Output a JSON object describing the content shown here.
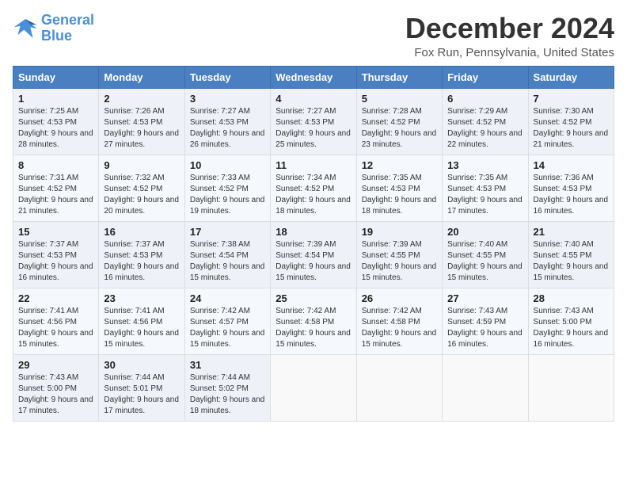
{
  "logo": {
    "line1": "General",
    "line2": "Blue"
  },
  "title": "December 2024",
  "location": "Fox Run, Pennsylvania, United States",
  "weekdays": [
    "Sunday",
    "Monday",
    "Tuesday",
    "Wednesday",
    "Thursday",
    "Friday",
    "Saturday"
  ],
  "weeks": [
    [
      {
        "day": "1",
        "sunrise": "Sunrise: 7:25 AM",
        "sunset": "Sunset: 4:53 PM",
        "daylight": "Daylight: 9 hours and 28 minutes."
      },
      {
        "day": "2",
        "sunrise": "Sunrise: 7:26 AM",
        "sunset": "Sunset: 4:53 PM",
        "daylight": "Daylight: 9 hours and 27 minutes."
      },
      {
        "day": "3",
        "sunrise": "Sunrise: 7:27 AM",
        "sunset": "Sunset: 4:53 PM",
        "daylight": "Daylight: 9 hours and 26 minutes."
      },
      {
        "day": "4",
        "sunrise": "Sunrise: 7:27 AM",
        "sunset": "Sunset: 4:53 PM",
        "daylight": "Daylight: 9 hours and 25 minutes."
      },
      {
        "day": "5",
        "sunrise": "Sunrise: 7:28 AM",
        "sunset": "Sunset: 4:52 PM",
        "daylight": "Daylight: 9 hours and 23 minutes."
      },
      {
        "day": "6",
        "sunrise": "Sunrise: 7:29 AM",
        "sunset": "Sunset: 4:52 PM",
        "daylight": "Daylight: 9 hours and 22 minutes."
      },
      {
        "day": "7",
        "sunrise": "Sunrise: 7:30 AM",
        "sunset": "Sunset: 4:52 PM",
        "daylight": "Daylight: 9 hours and 21 minutes."
      }
    ],
    [
      {
        "day": "8",
        "sunrise": "Sunrise: 7:31 AM",
        "sunset": "Sunset: 4:52 PM",
        "daylight": "Daylight: 9 hours and 21 minutes."
      },
      {
        "day": "9",
        "sunrise": "Sunrise: 7:32 AM",
        "sunset": "Sunset: 4:52 PM",
        "daylight": "Daylight: 9 hours and 20 minutes."
      },
      {
        "day": "10",
        "sunrise": "Sunrise: 7:33 AM",
        "sunset": "Sunset: 4:52 PM",
        "daylight": "Daylight: 9 hours and 19 minutes."
      },
      {
        "day": "11",
        "sunrise": "Sunrise: 7:34 AM",
        "sunset": "Sunset: 4:52 PM",
        "daylight": "Daylight: 9 hours and 18 minutes."
      },
      {
        "day": "12",
        "sunrise": "Sunrise: 7:35 AM",
        "sunset": "Sunset: 4:53 PM",
        "daylight": "Daylight: 9 hours and 18 minutes."
      },
      {
        "day": "13",
        "sunrise": "Sunrise: 7:35 AM",
        "sunset": "Sunset: 4:53 PM",
        "daylight": "Daylight: 9 hours and 17 minutes."
      },
      {
        "day": "14",
        "sunrise": "Sunrise: 7:36 AM",
        "sunset": "Sunset: 4:53 PM",
        "daylight": "Daylight: 9 hours and 16 minutes."
      }
    ],
    [
      {
        "day": "15",
        "sunrise": "Sunrise: 7:37 AM",
        "sunset": "Sunset: 4:53 PM",
        "daylight": "Daylight: 9 hours and 16 minutes."
      },
      {
        "day": "16",
        "sunrise": "Sunrise: 7:37 AM",
        "sunset": "Sunset: 4:53 PM",
        "daylight": "Daylight: 9 hours and 16 minutes."
      },
      {
        "day": "17",
        "sunrise": "Sunrise: 7:38 AM",
        "sunset": "Sunset: 4:54 PM",
        "daylight": "Daylight: 9 hours and 15 minutes."
      },
      {
        "day": "18",
        "sunrise": "Sunrise: 7:39 AM",
        "sunset": "Sunset: 4:54 PM",
        "daylight": "Daylight: 9 hours and 15 minutes."
      },
      {
        "day": "19",
        "sunrise": "Sunrise: 7:39 AM",
        "sunset": "Sunset: 4:55 PM",
        "daylight": "Daylight: 9 hours and 15 minutes."
      },
      {
        "day": "20",
        "sunrise": "Sunrise: 7:40 AM",
        "sunset": "Sunset: 4:55 PM",
        "daylight": "Daylight: 9 hours and 15 minutes."
      },
      {
        "day": "21",
        "sunrise": "Sunrise: 7:40 AM",
        "sunset": "Sunset: 4:55 PM",
        "daylight": "Daylight: 9 hours and 15 minutes."
      }
    ],
    [
      {
        "day": "22",
        "sunrise": "Sunrise: 7:41 AM",
        "sunset": "Sunset: 4:56 PM",
        "daylight": "Daylight: 9 hours and 15 minutes."
      },
      {
        "day": "23",
        "sunrise": "Sunrise: 7:41 AM",
        "sunset": "Sunset: 4:56 PM",
        "daylight": "Daylight: 9 hours and 15 minutes."
      },
      {
        "day": "24",
        "sunrise": "Sunrise: 7:42 AM",
        "sunset": "Sunset: 4:57 PM",
        "daylight": "Daylight: 9 hours and 15 minutes."
      },
      {
        "day": "25",
        "sunrise": "Sunrise: 7:42 AM",
        "sunset": "Sunset: 4:58 PM",
        "daylight": "Daylight: 9 hours and 15 minutes."
      },
      {
        "day": "26",
        "sunrise": "Sunrise: 7:42 AM",
        "sunset": "Sunset: 4:58 PM",
        "daylight": "Daylight: 9 hours and 15 minutes."
      },
      {
        "day": "27",
        "sunrise": "Sunrise: 7:43 AM",
        "sunset": "Sunset: 4:59 PM",
        "daylight": "Daylight: 9 hours and 16 minutes."
      },
      {
        "day": "28",
        "sunrise": "Sunrise: 7:43 AM",
        "sunset": "Sunset: 5:00 PM",
        "daylight": "Daylight: 9 hours and 16 minutes."
      }
    ],
    [
      {
        "day": "29",
        "sunrise": "Sunrise: 7:43 AM",
        "sunset": "Sunset: 5:00 PM",
        "daylight": "Daylight: 9 hours and 17 minutes."
      },
      {
        "day": "30",
        "sunrise": "Sunrise: 7:44 AM",
        "sunset": "Sunset: 5:01 PM",
        "daylight": "Daylight: 9 hours and 17 minutes."
      },
      {
        "day": "31",
        "sunrise": "Sunrise: 7:44 AM",
        "sunset": "Sunset: 5:02 PM",
        "daylight": "Daylight: 9 hours and 18 minutes."
      },
      null,
      null,
      null,
      null
    ]
  ]
}
